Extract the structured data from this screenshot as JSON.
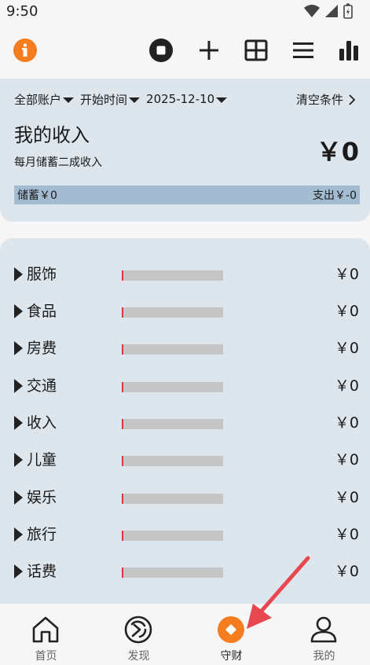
{
  "status": {
    "time": "9:50"
  },
  "filters": {
    "account": "全部账户",
    "start": "开始时间",
    "date": "2025-12-10",
    "clear": "清空条件"
  },
  "summary": {
    "title": "我的收入",
    "subtitle": "每月储蓄二成收入",
    "amount": "￥0",
    "savings": "储蓄￥0",
    "expense": "支出￥-0"
  },
  "categories": [
    {
      "name": "服饰",
      "value": "￥0"
    },
    {
      "name": "食品",
      "value": "￥0"
    },
    {
      "name": "房费",
      "value": "￥0"
    },
    {
      "name": "交通",
      "value": "￥0"
    },
    {
      "name": "收入",
      "value": "￥0"
    },
    {
      "name": "儿童",
      "value": "￥0"
    },
    {
      "name": "娱乐",
      "value": "￥0"
    },
    {
      "name": "旅行",
      "value": "￥0"
    },
    {
      "name": "话费",
      "value": "￥0"
    }
  ],
  "nav": [
    {
      "label": "首页"
    },
    {
      "label": "发现"
    },
    {
      "label": "守财"
    },
    {
      "label": "我的"
    }
  ],
  "colors": {
    "accent": "#f57c1f",
    "card": "#dde6ec",
    "savings_bar": "#a3bcd1",
    "pointer": "#e8474f"
  }
}
